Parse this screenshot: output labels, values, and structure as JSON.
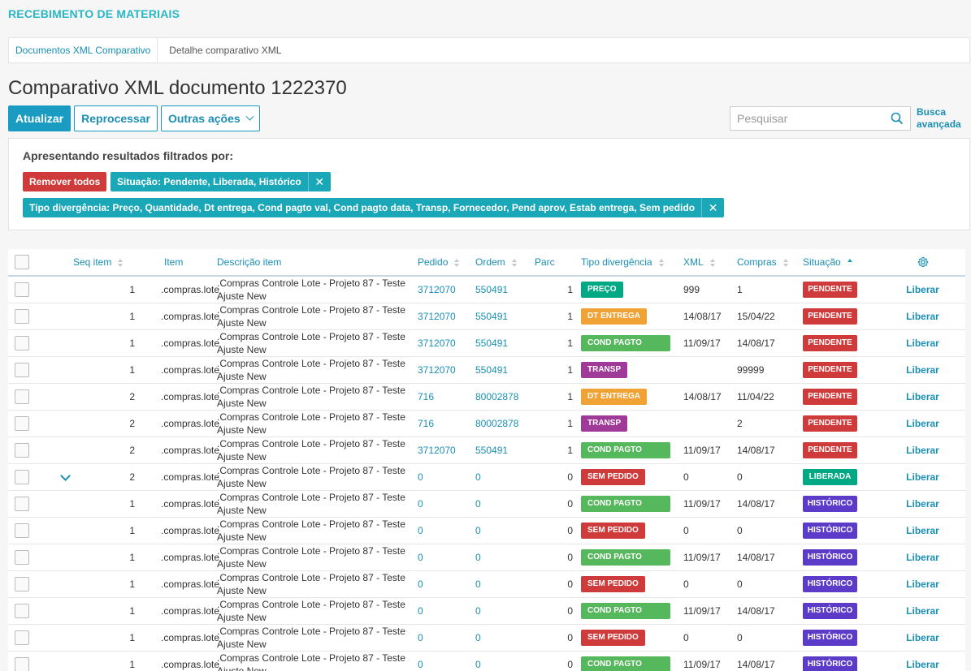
{
  "app": {
    "title": "RECEBIMENTO DE MATERIAIS"
  },
  "breadcrumb": {
    "link": "Documentos XML Comparativo",
    "current": "Detalhe comparativo XML"
  },
  "page": {
    "title": "Comparativo XML documento 1222370"
  },
  "toolbar": {
    "atualizar": "Atualizar",
    "reprocessar": "Reprocessar",
    "outras": "Outras ações"
  },
  "search": {
    "placeholder": "Pesquisar",
    "advanced_line1": "Busca",
    "advanced_line2": "avançada"
  },
  "filters": {
    "title": "Apresentando resultados filtrados por:",
    "remove_all": "Remover todos",
    "situacao": "Situação: Pendente, Liberada, Histórico",
    "tipo": "Tipo divergência: Preço, Quantidade, Dt entrega, Cond pagto val, Cond pagto data, Transp, Fornecedor, Pend aprov, Estab entrega, Sem pedido"
  },
  "table": {
    "columns": {
      "seq": "Seq item",
      "item": "Item",
      "desc": "Descrição item",
      "pedido": "Pedido",
      "ordem": "Ordem",
      "parc": "Parc",
      "tipo": "Tipo divergência",
      "xml": "XML",
      "compras": "Compras",
      "situacao": "Situação"
    },
    "action_label": "Liberar",
    "rows": [
      {
        "seq": "1",
        "item": ".compras.lote",
        "desc": ".Compras Controle Lote - Projeto 87 - Teste Ajuste New",
        "pedido": "3712070",
        "ordem": "550491",
        "parc": "1",
        "tipo": "PREÇO",
        "tipo_class": "tag-preco",
        "xml": "999",
        "compras": "1",
        "situacao": "PENDENTE",
        "sit_class": "tag-pend",
        "expand": false
      },
      {
        "seq": "1",
        "item": ".compras.lote",
        "desc": ".Compras Controle Lote - Projeto 87 - Teste Ajuste New",
        "pedido": "3712070",
        "ordem": "550491",
        "parc": "1",
        "tipo": "DT ENTREGA",
        "tipo_class": "tag-dt",
        "xml": "14/08/17",
        "compras": "15/04/22",
        "situacao": "PENDENTE",
        "sit_class": "tag-pend",
        "expand": false
      },
      {
        "seq": "1",
        "item": ".compras.lote",
        "desc": ".Compras Controle Lote - Projeto 87 - Teste Ajuste New",
        "pedido": "3712070",
        "ordem": "550491",
        "parc": "1",
        "tipo": "COND PAGTO",
        "tipo_class": "tag-cond",
        "xml": "11/09/17",
        "compras": "14/08/17",
        "situacao": "PENDENTE",
        "sit_class": "tag-pend",
        "expand": false
      },
      {
        "seq": "1",
        "item": ".compras.lote",
        "desc": ".Compras Controle Lote - Projeto 87 - Teste Ajuste New",
        "pedido": "3712070",
        "ordem": "550491",
        "parc": "1",
        "tipo": "TRANSP",
        "tipo_class": "tag-transp",
        "xml": "",
        "compras": "99999",
        "situacao": "PENDENTE",
        "sit_class": "tag-pend",
        "expand": false
      },
      {
        "seq": "2",
        "item": ".compras.lote",
        "desc": ".Compras Controle Lote - Projeto 87 - Teste Ajuste New",
        "pedido": "716",
        "ordem": "80002878",
        "parc": "1",
        "tipo": "DT ENTREGA",
        "tipo_class": "tag-dt",
        "xml": "14/08/17",
        "compras": "11/04/22",
        "situacao": "PENDENTE",
        "sit_class": "tag-pend",
        "expand": false
      },
      {
        "seq": "2",
        "item": ".compras.lote",
        "desc": ".Compras Controle Lote - Projeto 87 - Teste Ajuste New",
        "pedido": "716",
        "ordem": "80002878",
        "parc": "1",
        "tipo": "TRANSP",
        "tipo_class": "tag-transp",
        "xml": "",
        "compras": "2",
        "situacao": "PENDENTE",
        "sit_class": "tag-pend",
        "expand": false
      },
      {
        "seq": "2",
        "item": ".compras.lote",
        "desc": ".Compras Controle Lote - Projeto 87 - Teste Ajuste New",
        "pedido": "3712070",
        "ordem": "550491",
        "parc": "1",
        "tipo": "COND PAGTO",
        "tipo_class": "tag-cond",
        "xml": "11/09/17",
        "compras": "14/08/17",
        "situacao": "PENDENTE",
        "sit_class": "tag-pend",
        "expand": false
      },
      {
        "seq": "2",
        "item": ".compras.lote",
        "desc": ".Compras Controle Lote - Projeto 87 - Teste Ajuste New",
        "pedido": "0",
        "ordem": "0",
        "parc": "0",
        "tipo": "SEM PEDIDO",
        "tipo_class": "tag-sem",
        "xml": "0",
        "compras": "0",
        "situacao": "LIBERADA",
        "sit_class": "tag-lib",
        "expand": true
      },
      {
        "seq": "1",
        "item": ".compras.lote",
        "desc": ".Compras Controle Lote - Projeto 87 - Teste Ajuste New",
        "pedido": "0",
        "ordem": "0",
        "parc": "0",
        "tipo": "COND PAGTO",
        "tipo_class": "tag-cond",
        "xml": "11/09/17",
        "compras": "14/08/17",
        "situacao": "HISTÓRICO",
        "sit_class": "tag-hist",
        "expand": false
      },
      {
        "seq": "1",
        "item": ".compras.lote",
        "desc": ".Compras Controle Lote - Projeto 87 - Teste Ajuste New",
        "pedido": "0",
        "ordem": "0",
        "parc": "0",
        "tipo": "SEM PEDIDO",
        "tipo_class": "tag-sem",
        "xml": "0",
        "compras": "0",
        "situacao": "HISTÓRICO",
        "sit_class": "tag-hist",
        "expand": false
      },
      {
        "seq": "1",
        "item": ".compras.lote",
        "desc": ".Compras Controle Lote - Projeto 87 - Teste Ajuste New",
        "pedido": "0",
        "ordem": "0",
        "parc": "0",
        "tipo": "COND PAGTO",
        "tipo_class": "tag-cond",
        "xml": "11/09/17",
        "compras": "14/08/17",
        "situacao": "HISTÓRICO",
        "sit_class": "tag-hist",
        "expand": false
      },
      {
        "seq": "1",
        "item": ".compras.lote",
        "desc": ".Compras Controle Lote - Projeto 87 - Teste Ajuste New",
        "pedido": "0",
        "ordem": "0",
        "parc": "0",
        "tipo": "SEM PEDIDO",
        "tipo_class": "tag-sem",
        "xml": "0",
        "compras": "0",
        "situacao": "HISTÓRICO",
        "sit_class": "tag-hist",
        "expand": false
      },
      {
        "seq": "1",
        "item": ".compras.lote",
        "desc": ".Compras Controle Lote - Projeto 87 - Teste Ajuste New",
        "pedido": "0",
        "ordem": "0",
        "parc": "0",
        "tipo": "COND PAGTO",
        "tipo_class": "tag-cond",
        "xml": "11/09/17",
        "compras": "14/08/17",
        "situacao": "HISTÓRICO",
        "sit_class": "tag-hist",
        "expand": false
      },
      {
        "seq": "1",
        "item": ".compras.lote",
        "desc": ".Compras Controle Lote - Projeto 87 - Teste Ajuste New",
        "pedido": "0",
        "ordem": "0",
        "parc": "0",
        "tipo": "SEM PEDIDO",
        "tipo_class": "tag-sem",
        "xml": "0",
        "compras": "0",
        "situacao": "HISTÓRICO",
        "sit_class": "tag-hist",
        "expand": false
      },
      {
        "seq": "1",
        "item": ".compras.lote",
        "desc": ".Compras Controle Lote - Projeto 87 - Teste Ajuste New",
        "pedido": "0",
        "ordem": "0",
        "parc": "0",
        "tipo": "COND PAGTO",
        "tipo_class": "tag-cond",
        "xml": "11/09/17",
        "compras": "14/08/17",
        "situacao": "HISTÓRICO",
        "sit_class": "tag-hist",
        "expand": false
      }
    ]
  }
}
